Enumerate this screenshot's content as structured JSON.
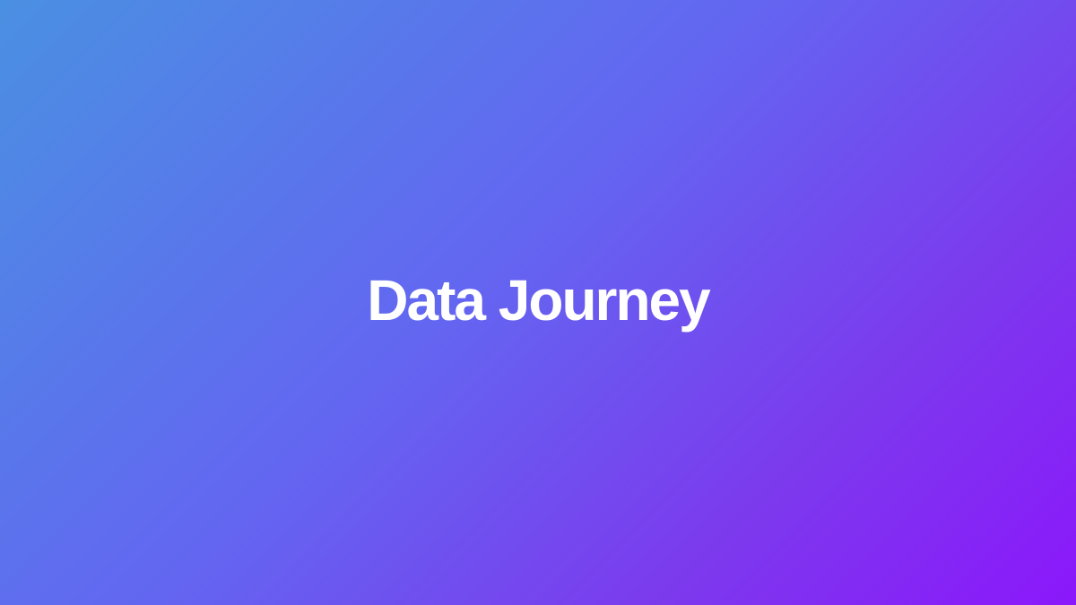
{
  "hero": {
    "title": "Data Journey",
    "title_color": "#ffffff",
    "background_gradient": [
      "#4a90e2",
      "#6366f1",
      "#7c3aed",
      "#8b17fb"
    ]
  }
}
